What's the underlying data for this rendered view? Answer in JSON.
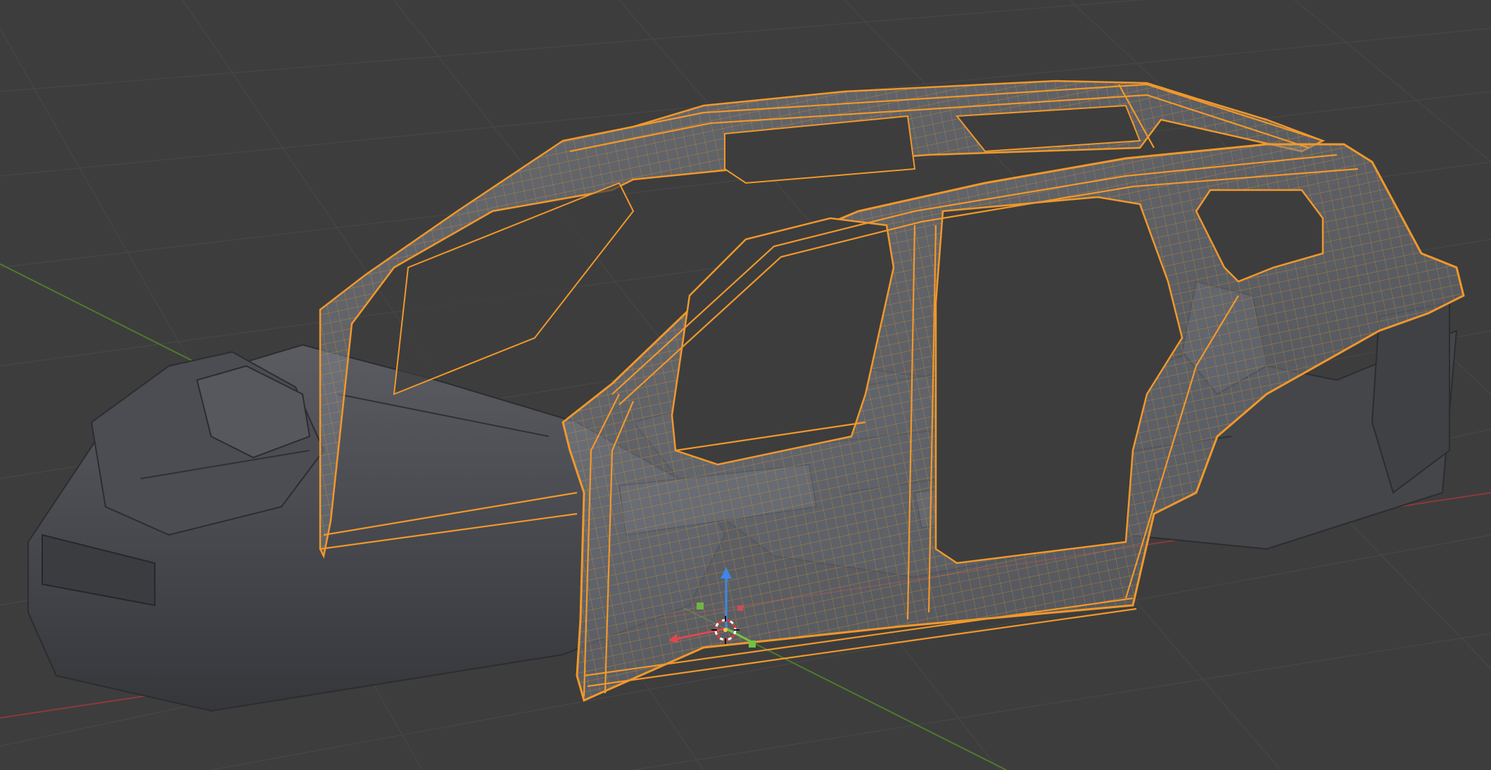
{
  "viewport": {
    "view": "3d-perspective",
    "shading": "solid-with-wireframe-overlay",
    "background_color": "#3d3d3d",
    "grid_color": "#4a4a4a",
    "x_axis_color": "#8a3a3a",
    "y_axis_color": "#4f7a2c"
  },
  "scene": {
    "objects": [
      {
        "name": "body-side-panel",
        "state": "selected",
        "outline_color": "#f2982a",
        "fill_color": "#6f7784"
      },
      {
        "name": "chassis-underbody",
        "state": "unselected",
        "fill_color": "#4a4c51"
      }
    ]
  },
  "gizmo": {
    "type": "object-origin-transform",
    "icons": [
      "3d-cursor-icon",
      "z-arrow-icon",
      "x-handle-icon",
      "y-handle-icon"
    ],
    "x_color": "#e0474f",
    "y_color": "#72c340",
    "z_color": "#3e86e8"
  }
}
